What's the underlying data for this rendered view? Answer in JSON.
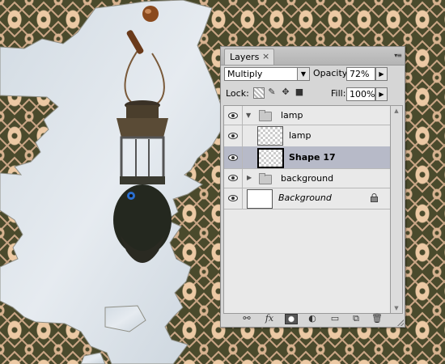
{
  "panel": {
    "tab_label": "Layers",
    "tab_close": "×",
    "menu_glyph": "▾≡",
    "blend_mode": "Multiply",
    "opacity_label": "Opacity:",
    "opacity_value": "72%",
    "lock_label": "Lock:",
    "fill_label": "Fill:",
    "fill_value": "100%"
  },
  "layers": [
    {
      "name": "lamp",
      "type": "group",
      "expanded": true,
      "visible": true
    },
    {
      "name": "lamp",
      "type": "layer",
      "visible": true
    },
    {
      "name": "Shape 17",
      "type": "shape",
      "visible": true,
      "selected": true
    },
    {
      "name": "background",
      "type": "group",
      "expanded": false,
      "visible": true
    },
    {
      "name": "Background",
      "type": "background",
      "visible": true,
      "locked": true
    }
  ],
  "colors": {
    "selection": "#b7bac8",
    "damask_dark": "#4a4a2c",
    "damask_light": "#ecc9a4"
  }
}
